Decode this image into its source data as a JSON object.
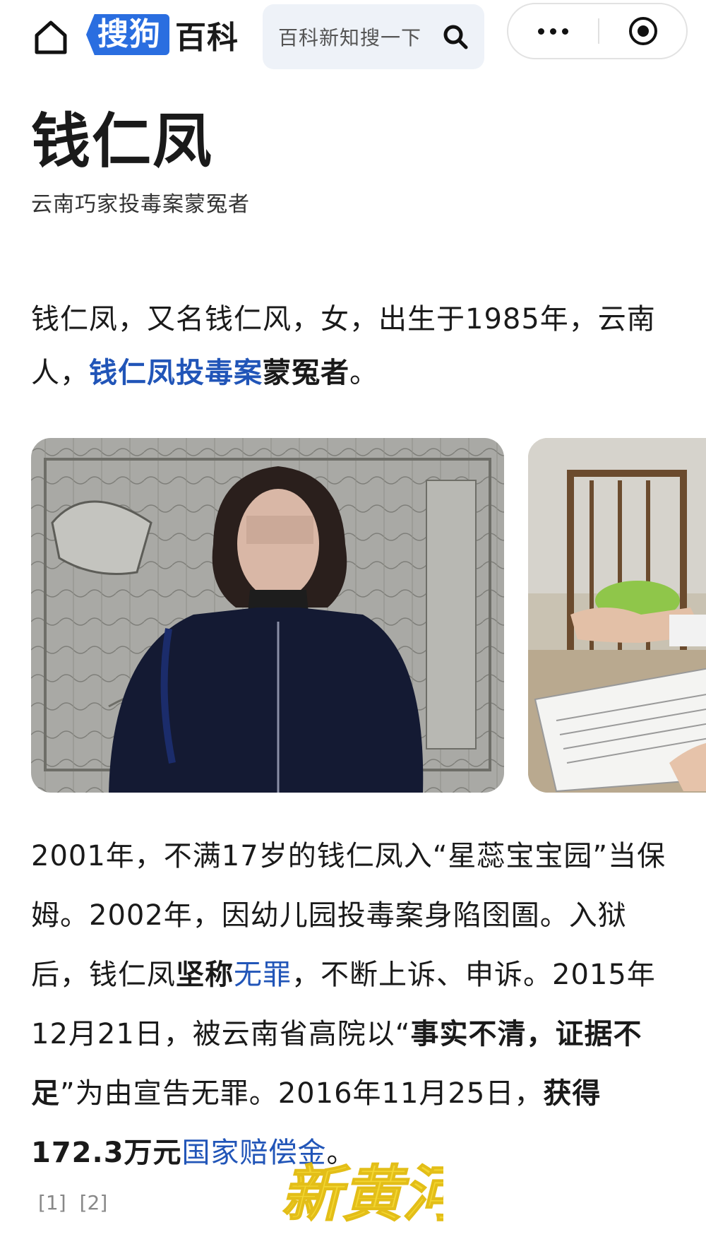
{
  "header": {
    "logo_badge": "搜狗",
    "logo_text": "百科",
    "search_placeholder": "百科新知搜一下",
    "icons": [
      "home-icon",
      "search-icon",
      "more-icon",
      "target-icon"
    ]
  },
  "entry": {
    "title": "钱仁凤",
    "subtitle": "云南巧家投毒案蒙冤者",
    "intro": {
      "t1": "钱仁凤，又名钱仁风，女，出生于1985年，云南人，",
      "link": "钱仁凤投毒案",
      "bold": "蒙冤者",
      "t2": "。"
    },
    "detail": {
      "t1": "2001年，不满17岁的钱仁凤入“星蕊宝宝园”当保姆。2002年，因幼儿园投毒案身陷囹圄。入狱后，钱仁凤",
      "b1": "坚称",
      "link1": "无罪",
      "t2": "，不断上诉、申诉。2015年12月21日，被云南省高院以“",
      "b2": "事实不清，证据不足",
      "t3": "”为由宣告无罪。2016年11月25日，",
      "b3": "获得172.3万元",
      "link2": "国家赔偿金",
      "t4": "。"
    },
    "refs": [
      "[1]",
      "[2]"
    ]
  },
  "watermark_text": "新黄河",
  "colors": {
    "brand_blue": "#2a6ee0",
    "link_blue": "#2155b8",
    "search_bg": "#eef2f8",
    "watermark": "#f2d21b"
  }
}
